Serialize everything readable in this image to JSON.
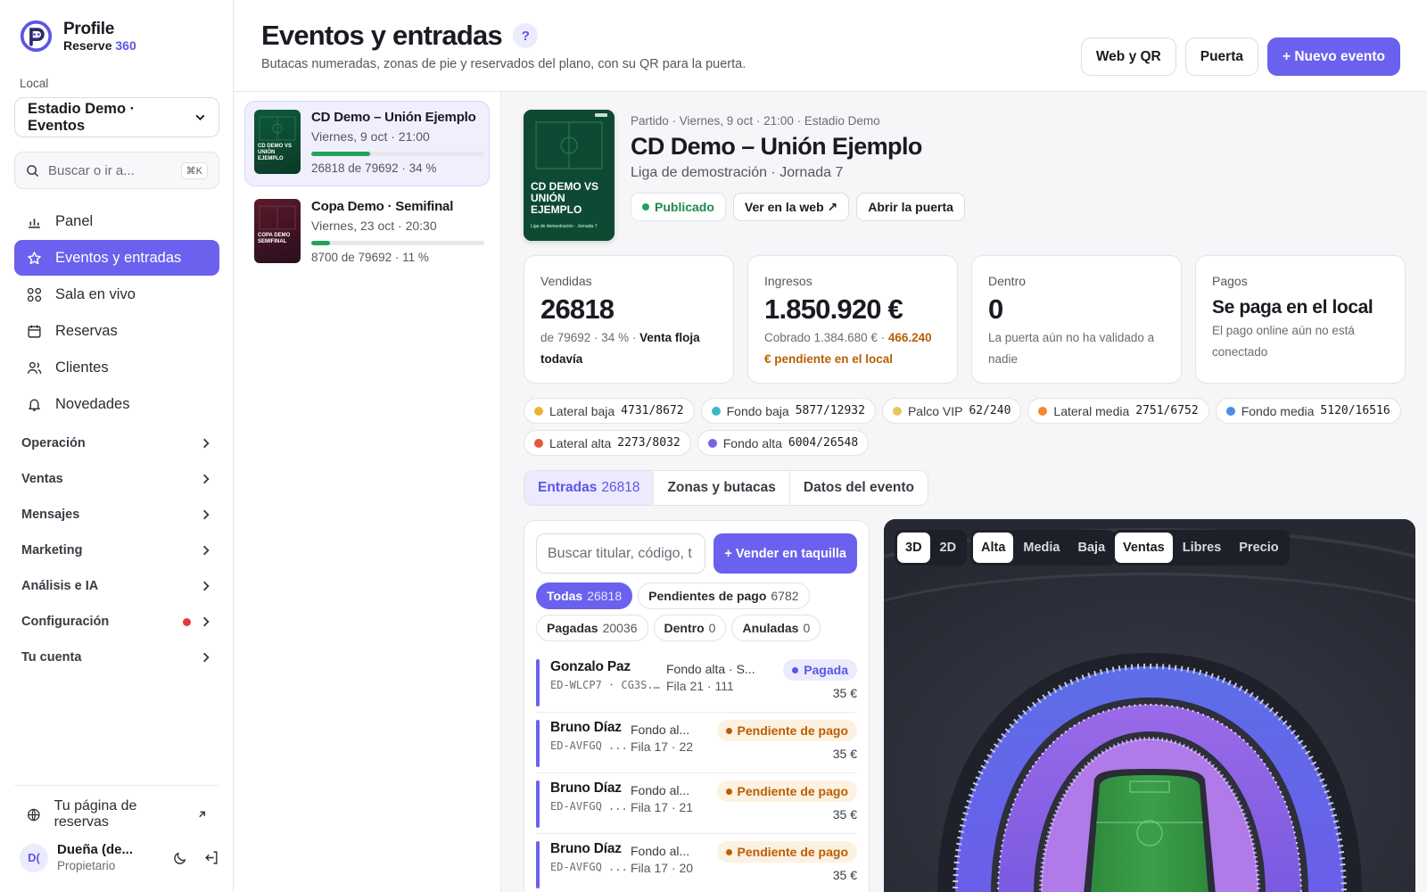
{
  "brand": {
    "name": "Profile",
    "sub_prefix": "Reserve",
    "sub_num": "360"
  },
  "sidebar": {
    "local_label": "Local",
    "local_value": "Estadio Demo · Eventos",
    "search_placeholder": "Buscar o ir a...",
    "search_shortcut": "⌘K",
    "nav": [
      {
        "label": "Panel",
        "icon": "chart-icon"
      },
      {
        "label": "Eventos y entradas",
        "icon": "star-icon",
        "active": true
      },
      {
        "label": "Sala en vivo",
        "icon": "grid-icon"
      },
      {
        "label": "Reservas",
        "icon": "calendar-icon"
      },
      {
        "label": "Clientes",
        "icon": "users-icon"
      },
      {
        "label": "Novedades",
        "icon": "bell-icon"
      }
    ],
    "groups": [
      "Operación",
      "Ventas",
      "Mensajes",
      "Marketing",
      "Análisis e IA",
      "Configuración",
      "Tu cuenta"
    ],
    "booking_link": "Tu página de reservas",
    "user": {
      "initials": "D(",
      "name": "Dueña (de...",
      "role": "Propietario"
    }
  },
  "header": {
    "title": "Eventos y entradas",
    "help": "?",
    "subtitle": "Butacas numeradas, zonas de pie y reservados del plano, con su QR para la puerta.",
    "btn_web": "Web y QR",
    "btn_door": "Puerta",
    "btn_new": "+ Nuevo evento"
  },
  "events": [
    {
      "title": "CD Demo – Unión Ejemplo",
      "date": "Viernes, 9 oct · 21:00",
      "count": "26818 de 79692 · 34 %",
      "progress": 0.34,
      "thumb": "CD DEMO VS UNIÓN EJEMPLO"
    },
    {
      "title": "Copa Demo · Semifinal",
      "date": "Viernes, 23 oct · 20:30",
      "count": "8700 de 79692 · 11 %",
      "progress": 0.11,
      "thumb": "COPA DEMO SEMIFINAL"
    }
  ],
  "detail": {
    "poster_title": "CD DEMO VS UNIÓN EJEMPLO",
    "poster_sub": "Liga de demostración · Jornada 7",
    "meta": "Partido · Viernes, 9 oct · 21:00 · Estadio Demo",
    "name": "CD Demo – Unión Ejemplo",
    "league": "Liga de demostración · Jornada 7",
    "status": "Publicado",
    "btn_web": "Ver en la web ↗",
    "btn_door": "Abrir la puerta"
  },
  "stats": {
    "sold": {
      "label": "Vendidas",
      "value": "26818",
      "note": "de 79692 · 34 % ·",
      "note_bold": "Venta floja todavía"
    },
    "revenue": {
      "label": "Ingresos",
      "value": "1.850.920 €",
      "note": "Cobrado 1.384.680 € ·",
      "note_warn": "466.240 € pendiente en el local"
    },
    "inside": {
      "label": "Dentro",
      "value": "0",
      "note": "La puerta aún no ha validado a nadie"
    },
    "payments": {
      "label": "Pagos",
      "value": "Se paga en el local",
      "note": "El pago online aún no está conectado"
    }
  },
  "zones": [
    {
      "name": "Lateral baja",
      "value": "4731/8672",
      "color": "#e8b23a"
    },
    {
      "name": "Fondo baja",
      "value": "5877/12932",
      "color": "#3fb6c4"
    },
    {
      "name": "Palco VIP",
      "value": "62/240",
      "color": "#e8c85a"
    },
    {
      "name": "Lateral media",
      "value": "2751/6752",
      "color": "#ef8a32"
    },
    {
      "name": "Fondo media",
      "value": "5120/16516",
      "color": "#4a8ee8"
    },
    {
      "name": "Lateral alta",
      "value": "2273/8032",
      "color": "#e05a3a"
    },
    {
      "name": "Fondo alta",
      "value": "6004/26548",
      "color": "#7b61e8"
    }
  ],
  "tabs": [
    {
      "label": "Entradas",
      "count": "26818",
      "active": true
    },
    {
      "label": "Zonas y butacas",
      "count": ""
    },
    {
      "label": "Datos del evento",
      "count": ""
    }
  ],
  "tickets": {
    "search_placeholder": "Buscar titular, código, t",
    "sell_button": "+ Vender en taquilla",
    "filters": [
      {
        "label": "Todas",
        "count": "26818",
        "active": true
      },
      {
        "label": "Pendientes de pago",
        "count": "6782"
      },
      {
        "label": "Pagadas",
        "count": "20036"
      },
      {
        "label": "Dentro",
        "count": "0"
      },
      {
        "label": "Anuladas",
        "count": "0"
      }
    ],
    "rows": [
      {
        "name": "Gonzalo Paz",
        "code": "ED-WLCP7 · CG3S...",
        "zone": "Fondo alta · S...",
        "row": "Fila 21 · 111",
        "status": "Pagada",
        "kind": "paid",
        "price": "35 €"
      },
      {
        "name": "Bruno Díaz",
        "code": "ED-AVFGQ ...",
        "zone": "Fondo al...",
        "row": "Fila 17 · 22",
        "status": "Pendiente de pago",
        "kind": "pend",
        "price": "35 €"
      },
      {
        "name": "Bruno Díaz",
        "code": "ED-AVFGQ ...",
        "zone": "Fondo al...",
        "row": "Fila 17 · 21",
        "status": "Pendiente de pago",
        "kind": "pend",
        "price": "35 €"
      },
      {
        "name": "Bruno Díaz",
        "code": "ED-AVFGQ ...",
        "zone": "Fondo al...",
        "row": "Fila 17 · 20",
        "status": "Pendiente de pago",
        "kind": "pend",
        "price": "35 €"
      }
    ]
  },
  "map": {
    "view": [
      "3D",
      "2D"
    ],
    "view_active": "3D",
    "level": [
      "Alta",
      "Media",
      "Baja"
    ],
    "level_active": "Alta",
    "mode": [
      "Ventas",
      "Libres",
      "Precio"
    ],
    "mode_active": "Ventas"
  }
}
